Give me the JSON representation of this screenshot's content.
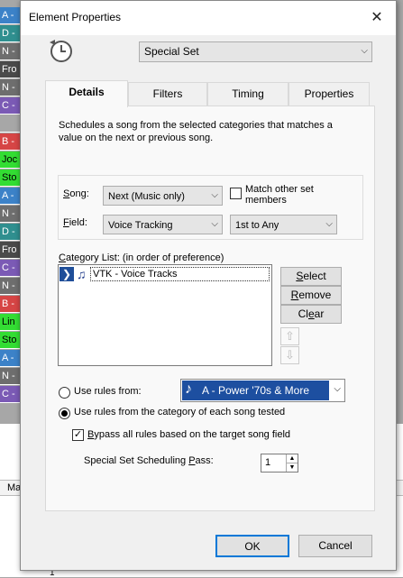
{
  "background": {
    "strips": [
      {
        "text": "A -",
        "color": "#3c82c8",
        "fg": "#fff"
      },
      {
        "text": "D -",
        "color": "#2f8f8f",
        "fg": "#fff"
      },
      {
        "text": "N -",
        "color": "#6e6e6e",
        "fg": "#fff"
      },
      {
        "text": "Fro",
        "color": "#4a4a4a",
        "fg": "#fff"
      },
      {
        "text": "N -",
        "color": "#6e6e6e",
        "fg": "#fff"
      },
      {
        "text": "C -",
        "color": "#7b5ab5",
        "fg": "#fff"
      },
      {
        "text": "",
        "color": "#a7a7a7",
        "fg": "#000"
      },
      {
        "text": "B -",
        "color": "#d64545",
        "fg": "#fff"
      },
      {
        "text": "Joc",
        "color": "#33dd33",
        "fg": "#000"
      },
      {
        "text": "Sto",
        "color": "#33dd33",
        "fg": "#000"
      },
      {
        "text": "A -",
        "color": "#3c82c8",
        "fg": "#fff"
      },
      {
        "text": "N -",
        "color": "#6e6e6e",
        "fg": "#fff"
      },
      {
        "text": "D -",
        "color": "#2f8f8f",
        "fg": "#fff"
      },
      {
        "text": "Fro",
        "color": "#4a4a4a",
        "fg": "#fff"
      },
      {
        "text": "C -",
        "color": "#7b5ab5",
        "fg": "#fff"
      },
      {
        "text": "N -",
        "color": "#6e6e6e",
        "fg": "#fff"
      },
      {
        "text": "B -",
        "color": "#d64545",
        "fg": "#fff"
      },
      {
        "text": "Lin",
        "color": "#33dd33",
        "fg": "#000"
      },
      {
        "text": "Sto",
        "color": "#33dd33",
        "fg": "#000"
      },
      {
        "text": "A -",
        "color": "#3c82c8",
        "fg": "#fff"
      },
      {
        "text": "N -",
        "color": "#6e6e6e",
        "fg": "#fff"
      },
      {
        "text": "C -",
        "color": "#7b5ab5",
        "fg": "#fff"
      }
    ],
    "grid_header": "Max",
    "grid_row": "1"
  },
  "dialog": {
    "title": "Element Properties",
    "close_glyph": "✕",
    "element_type": "Special Set",
    "tabs": [
      "Details",
      "Filters",
      "Timing",
      "Properties"
    ],
    "active_tab": "Details",
    "description": "Schedules a song from the selected categories that matches a value on the next or previous song.",
    "song": {
      "label_pre": "",
      "label_u": "S",
      "label_post": "ong:",
      "value": "Next (Music only)"
    },
    "match_other": {
      "label": "Match other set members",
      "checked": false
    },
    "field": {
      "label_u": "F",
      "label_post": "ield:",
      "value": "Voice Tracking",
      "range": "1st to Any"
    },
    "category_list": {
      "label_pre": "",
      "label_u": "C",
      "label_post": "ategory List: (in order of preference)",
      "items": [
        {
          "name": "VTK - Voice Tracks"
        }
      ]
    },
    "buttons": {
      "select": {
        "u": "S",
        "rest": "elect"
      },
      "remove": {
        "u": "R",
        "rest": "emove"
      },
      "clear": {
        "pre": "Cl",
        "u": "e",
        "rest": "ar"
      }
    },
    "use_rules_from": {
      "label": "Use rules from:",
      "selected": false,
      "value": "A - Power '70s & More",
      "color": "#1d4fa0"
    },
    "use_rules_each": {
      "label": "Use rules from the category of each song tested",
      "selected": true
    },
    "bypass": {
      "u": "B",
      "rest": "ypass all rules based on the target song field",
      "checked": true
    },
    "pass": {
      "pre": "Special Set Scheduling ",
      "u": "P",
      "rest": "ass:",
      "value": "1"
    },
    "ok_label": "OK",
    "cancel_label": "Cancel"
  }
}
